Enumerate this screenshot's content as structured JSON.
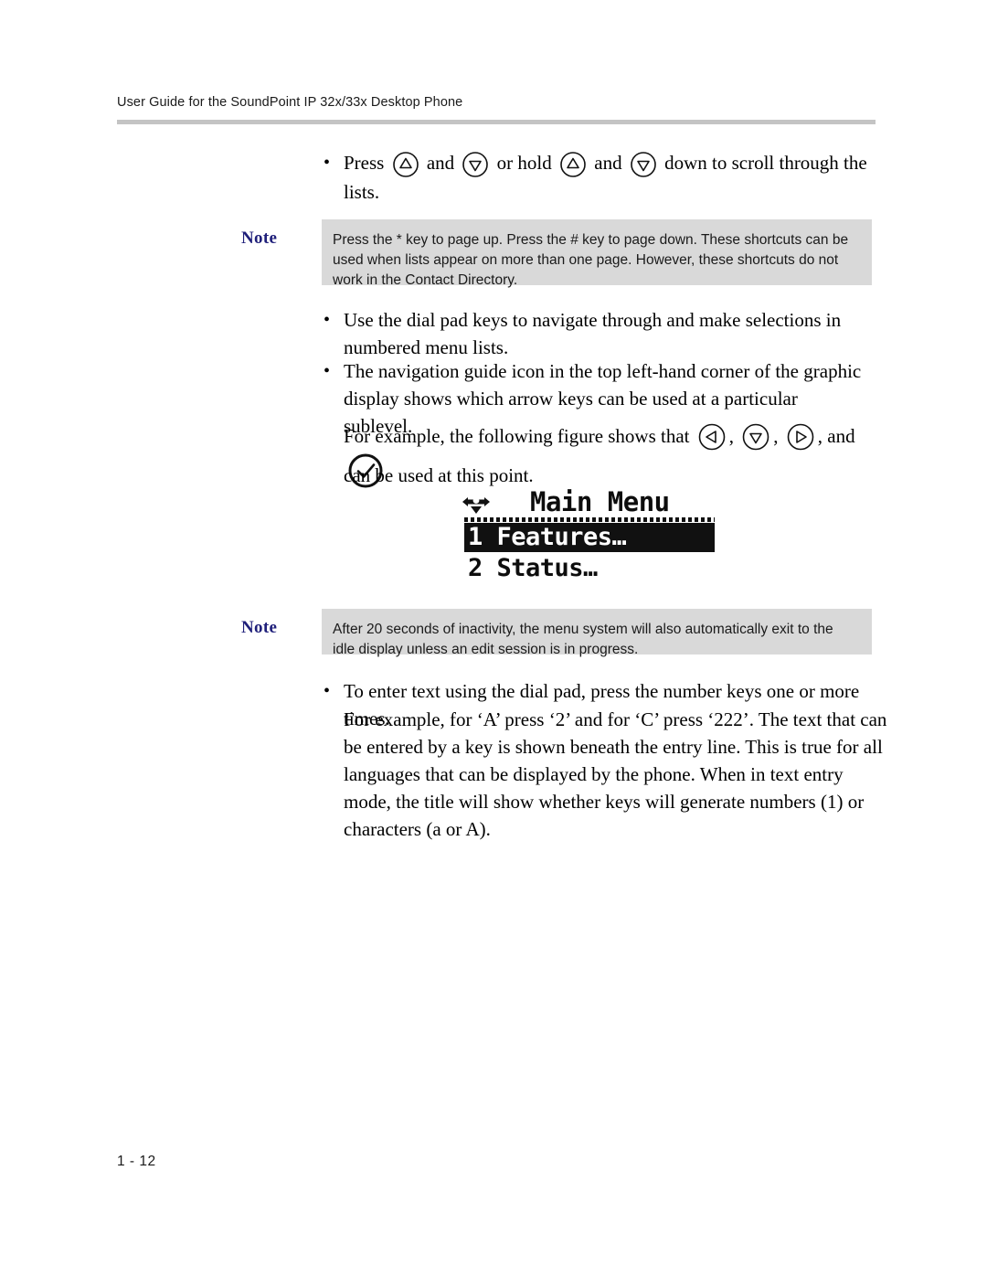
{
  "document": {
    "header_title": "User Guide for the SoundPoint IP 32x/33x Desktop Phone",
    "page_number": "1 - 12",
    "note_label": "Note",
    "accent_color": "#1f1f7a",
    "note_bg_color": "#d9d9d9",
    "rule_color": "#c4c4c4"
  },
  "bullets": {
    "scroll": {
      "text_1": "Press",
      "text_2": "and",
      "text_3": "or hold",
      "text_4": "and",
      "text_5": "down to scroll through the lists.",
      "icon_1": "up-arrow-key-icon",
      "icon_2": "down-arrow-key-icon",
      "icon_3": "up-arrow-key-icon",
      "icon_4": "down-arrow-key-icon"
    },
    "dial_pad": "Use the dial pad keys to navigate through and make selections in numbered menu lists.",
    "nav_guide": "The navigation guide icon in the top left-hand corner of the graphic display shows which arrow keys can be used at a particular sublevel.",
    "example": {
      "lead": "For example, the following figure shows that",
      "sep_1": ",",
      "sep_2": ",",
      "sep_3": ", and",
      "tail": "can be used at this point.",
      "icon_1": "left-arrow-key-icon",
      "icon_2": "down-arrow-key-icon",
      "icon_3": "right-arrow-key-icon",
      "icon_4": "check-select-key-icon"
    },
    "text_entry": {
      "line_1": "To enter text using the dial pad, press the number keys one or more times.",
      "line_2": "For example, for ‘A’ press ‘2’ and for ‘C’ press ‘222’. The text that can be entered by a key is shown beneath the entry line. This is true for all languages that can be displayed by the phone. When in text entry mode, the title will show whether keys will generate numbers (1) or characters (a or A)."
    },
    "marker": "•"
  },
  "notes": {
    "first": "Press the * key to page up. Press the # key to page down. These shortcuts can be used when lists appear on more than one page. However, these shortcuts do not work in the Contact Directory.",
    "second": "After 20 seconds of inactivity, the menu system will also automatically exit to the idle display unless an edit session is in progress."
  },
  "lcd_display": {
    "nav_icon": "navigation-guide-icon",
    "title": "Main Menu",
    "items": [
      {
        "label": "1 Features…",
        "selected": true
      },
      {
        "label": "2 Status…",
        "selected": false
      }
    ]
  }
}
